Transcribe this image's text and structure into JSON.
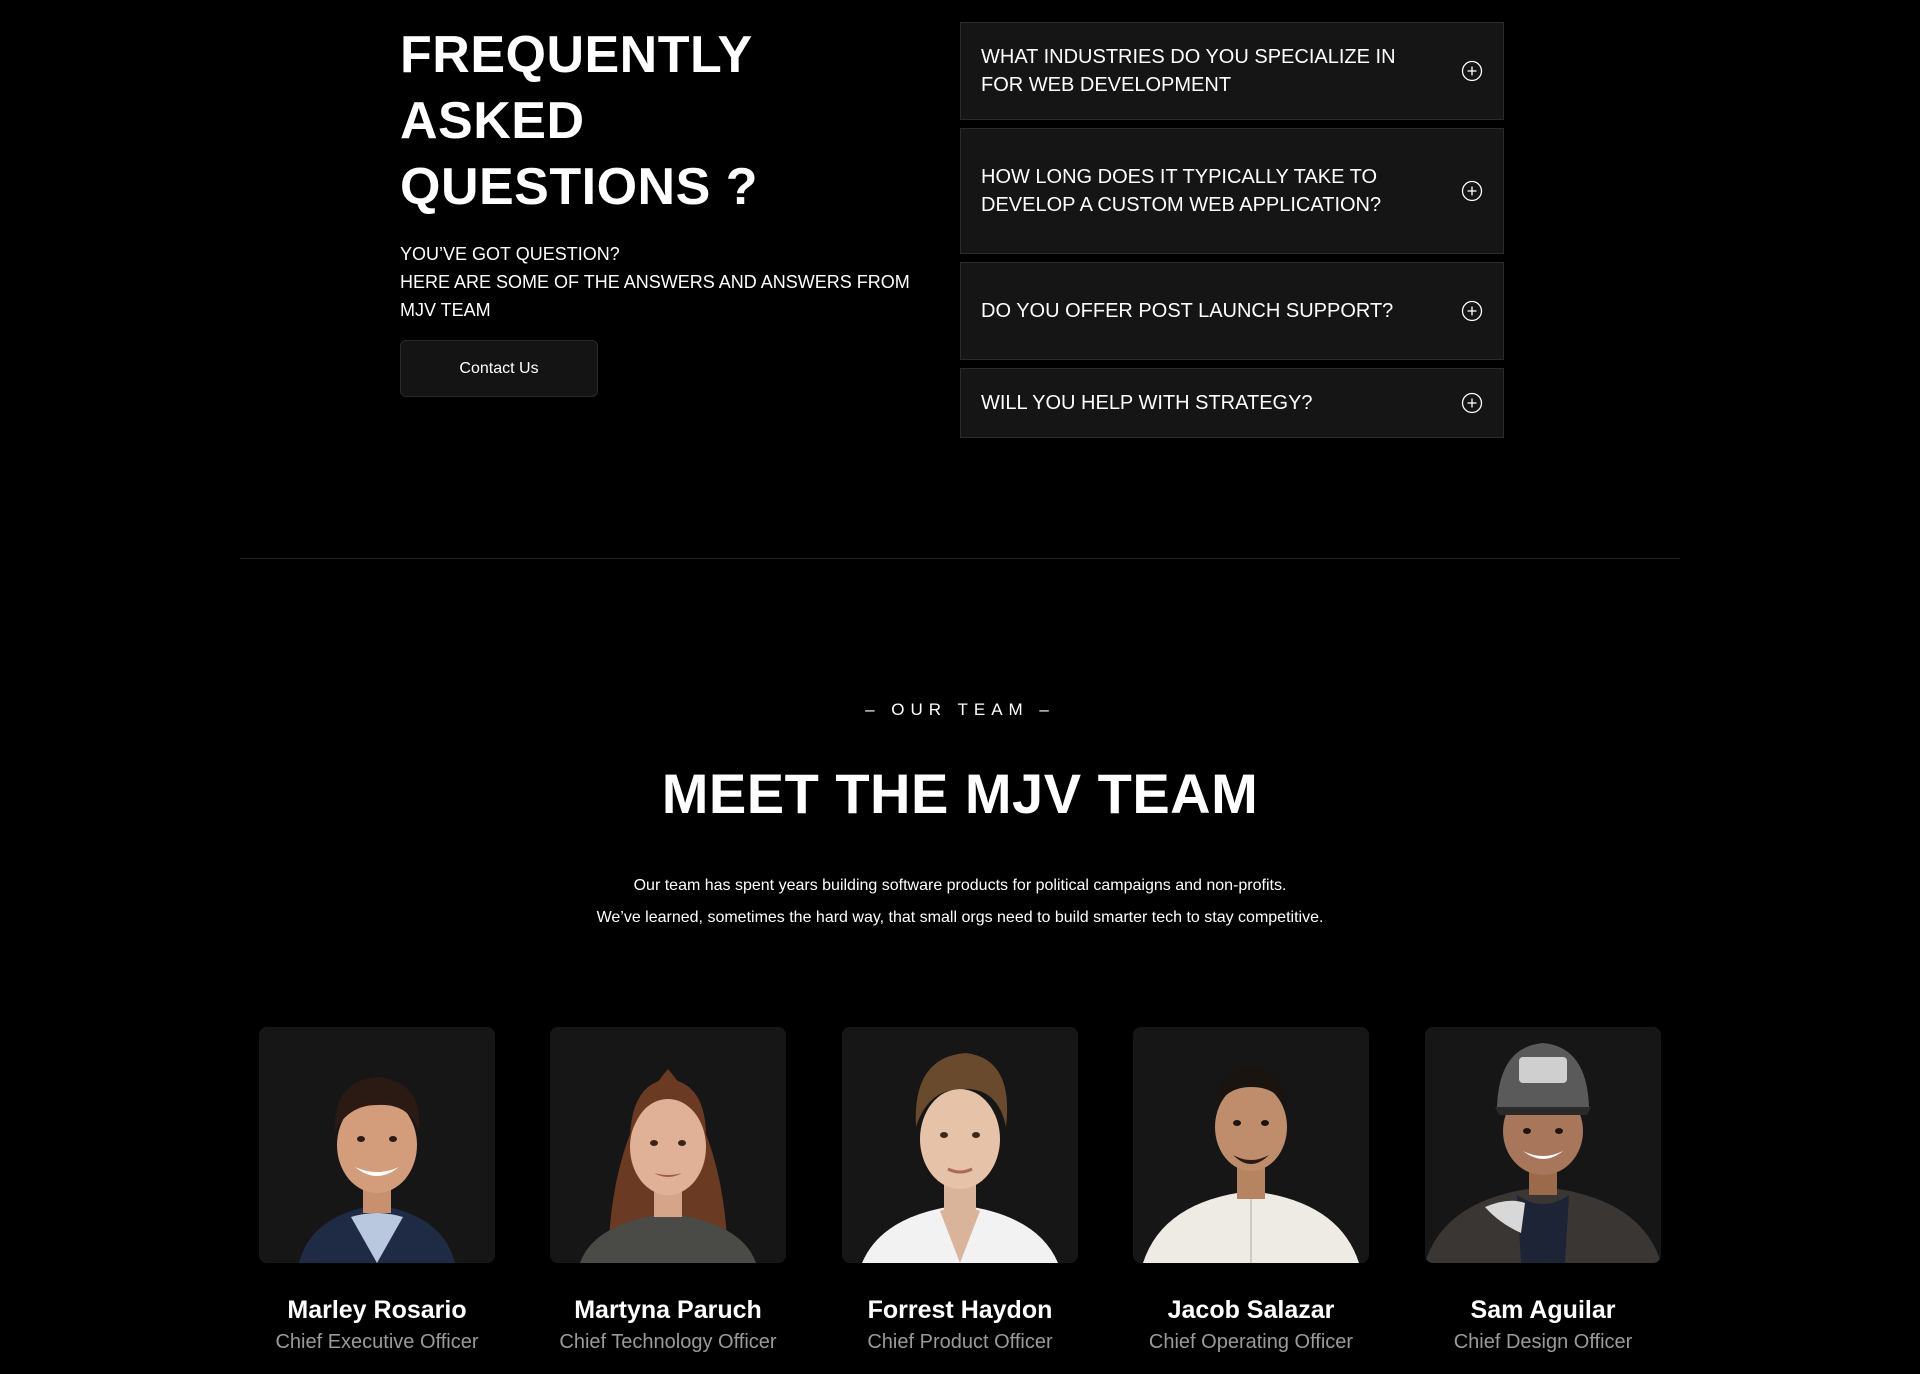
{
  "faq": {
    "title": "FREQUENTLY ASKED\nQUESTIONS ?",
    "subtitle": "YOU’VE GOT QUESTION?\nHERE ARE SOME OF THE ANSWERS AND ANSWERS FROM\nMJV TEAM",
    "contact_label": "Contact Us",
    "items": [
      {
        "question": "WHAT INDUSTRIES DO YOU SPECIALIZE IN FOR WEB DEVELOPMENT",
        "icon": "plus-circle-icon"
      },
      {
        "question": "HOW LONG DOES IT TYPICALLY TAKE TO DEVELOP A CUSTOM WEB APPLICATION?",
        "icon": "plus-circle-icon"
      },
      {
        "question": "DO YOU OFFER POST LAUNCH SUPPORT?",
        "icon": "plus-circle-icon"
      },
      {
        "question": "WILL YOU HELP WITH STRATEGY?",
        "icon": "plus-circle-icon"
      }
    ]
  },
  "team": {
    "eyebrow": "– OUR TEAM –",
    "title": "MEET THE MJV TEAM",
    "description": [
      "Our team has spent years building software products for political campaigns and non-profits.",
      "We’ve learned, sometimes the hard way, that small orgs need to build smarter tech to stay competitive."
    ],
    "members": [
      {
        "name": "Marley Rosario",
        "role": "Chief Executive Officer"
      },
      {
        "name": "Martyna Paruch",
        "role": "Chief Technology Officer"
      },
      {
        "name": "Forrest Haydon",
        "role": "Chief Product Officer"
      },
      {
        "name": "Jacob Salazar",
        "role": "Chief Operating Officer"
      },
      {
        "name": "Sam Aguilar",
        "role": "Chief Design Officer"
      }
    ]
  },
  "colors": {
    "background": "#000000",
    "card": "#151515",
    "border": "#2b2b2b",
    "muted_text": "#9a9a9a"
  }
}
